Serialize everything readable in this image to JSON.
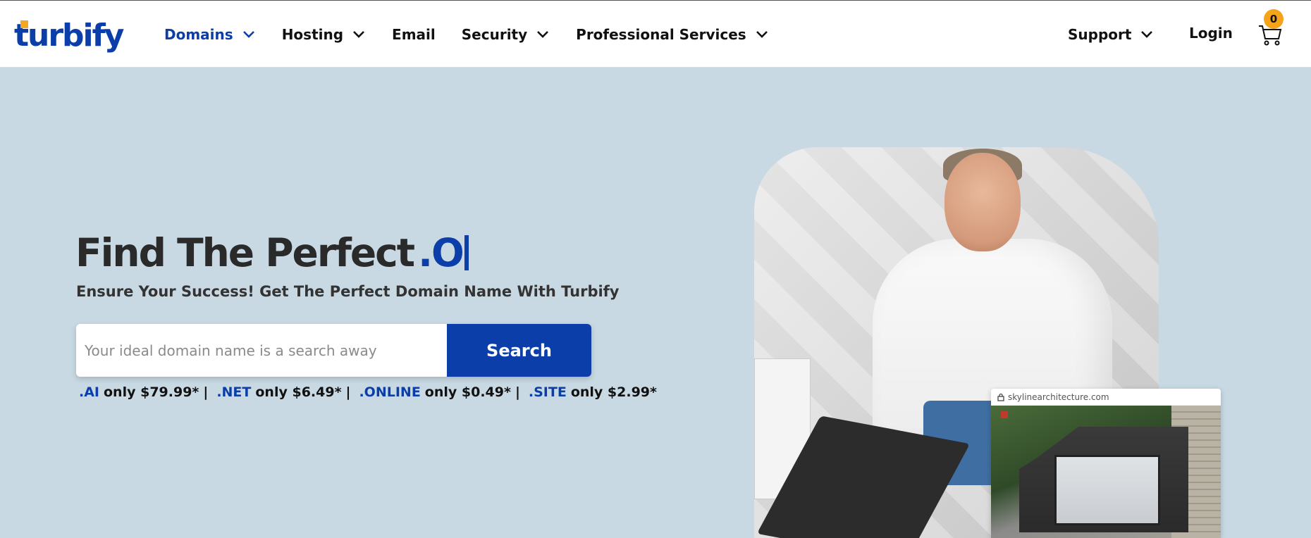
{
  "brand": {
    "name": "turbify",
    "accent": "#0b3ea8",
    "highlight": "#f5a623"
  },
  "nav": {
    "items": [
      {
        "label": "Domains",
        "dropdown": true,
        "active": true
      },
      {
        "label": "Hosting",
        "dropdown": true,
        "active": false
      },
      {
        "label": "Email",
        "dropdown": false,
        "active": false
      },
      {
        "label": "Security",
        "dropdown": true,
        "active": false
      },
      {
        "label": "Professional Services",
        "dropdown": true,
        "active": false
      }
    ],
    "support_label": "Support",
    "login_label": "Login",
    "cart_count": "0"
  },
  "hero": {
    "title": "Find The Perfect",
    "title_tld": ".O",
    "subtitle": "Ensure Your Success! Get The Perfect Domain Name With Turbify",
    "search_placeholder": "Your ideal domain name is a search away",
    "search_button": "Search",
    "offers": [
      {
        "tld": ".AI",
        "price": "only $79.99*"
      },
      {
        "tld": ".NET",
        "price": "only $6.49*"
      },
      {
        "tld": ".ONLINE",
        "price": "only $0.49*"
      },
      {
        "tld": ".SITE",
        "price": "only $2.99*"
      }
    ],
    "separator": "|"
  },
  "preview": {
    "url": "skylinearchitecture.com"
  },
  "icons": {
    "chevron": "chevron-down-icon",
    "cart": "cart-icon",
    "lock": "lock-icon"
  }
}
